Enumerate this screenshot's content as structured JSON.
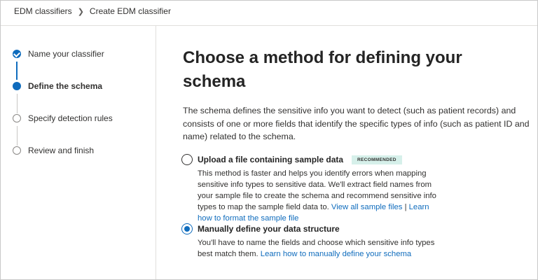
{
  "breadcrumb": {
    "items": [
      "EDM classifiers",
      "Create EDM classifier"
    ]
  },
  "steps": [
    {
      "label": "Name your classifier",
      "state": "done"
    },
    {
      "label": "Define the schema",
      "state": "current"
    },
    {
      "label": "Specify detection rules",
      "state": "todo"
    },
    {
      "label": "Review and finish",
      "state": "todo"
    }
  ],
  "main": {
    "title": "Choose a method for defining your schema",
    "description": "The schema defines the sensitive info you want to detect (such as patient records) and consists of one or more fields that identify the specific types of info (such as patient ID and name) related to the schema.",
    "options": [
      {
        "title": "Upload a file containing sample data",
        "badge": "RECOMMENDED",
        "selected": false,
        "description": "This method is faster and helps you identify errors when mapping sensitive info types to sensitive data. We'll extract field names from your sample file to create the schema and recommend sensitive info types to map the sample field data to.",
        "link1": "View all sample files",
        "separator": "|",
        "link2": "Learn how to format the sample file"
      },
      {
        "title": "Manually define your data structure",
        "selected": true,
        "description": "You'll have to name the fields and choose which sensitive info types best match them.",
        "link": "Learn how to manually define your schema"
      }
    ]
  },
  "colors": {
    "accent": "#0f6cbd",
    "badge_bg": "#d6f0ea",
    "divider": "#e1dfdd"
  }
}
